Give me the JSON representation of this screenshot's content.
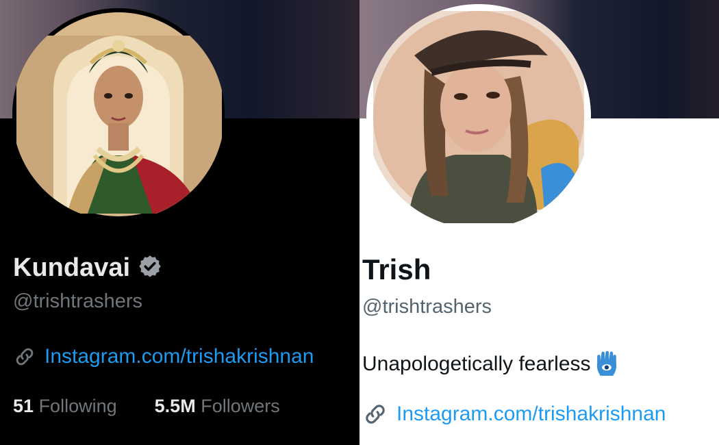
{
  "left": {
    "name": "Kundavai",
    "handle": "@trishtrashers",
    "link": "Instagram.com/trishakrishnan",
    "verified_icon": "verified-badge-icon",
    "link_icon": "link-icon",
    "following_count": "51",
    "following_label": "Following",
    "followers_count": "5.5M",
    "followers_label": "Followers",
    "colors": {
      "background": "#000000",
      "name": "#e7e9ea",
      "muted": "#71767b",
      "link": "#1d9bf0"
    }
  },
  "right": {
    "name": "Trish",
    "handle": "@trishtrashers",
    "bio": "Unapologetically fearless",
    "bio_icon": "hamsa-hand-icon",
    "link": "Instagram.com/trishakrishnan",
    "link_icon": "link-icon",
    "colors": {
      "background": "#ffffff",
      "name": "#0f1419",
      "muted": "#536471",
      "link": "#1d9bf0"
    }
  }
}
